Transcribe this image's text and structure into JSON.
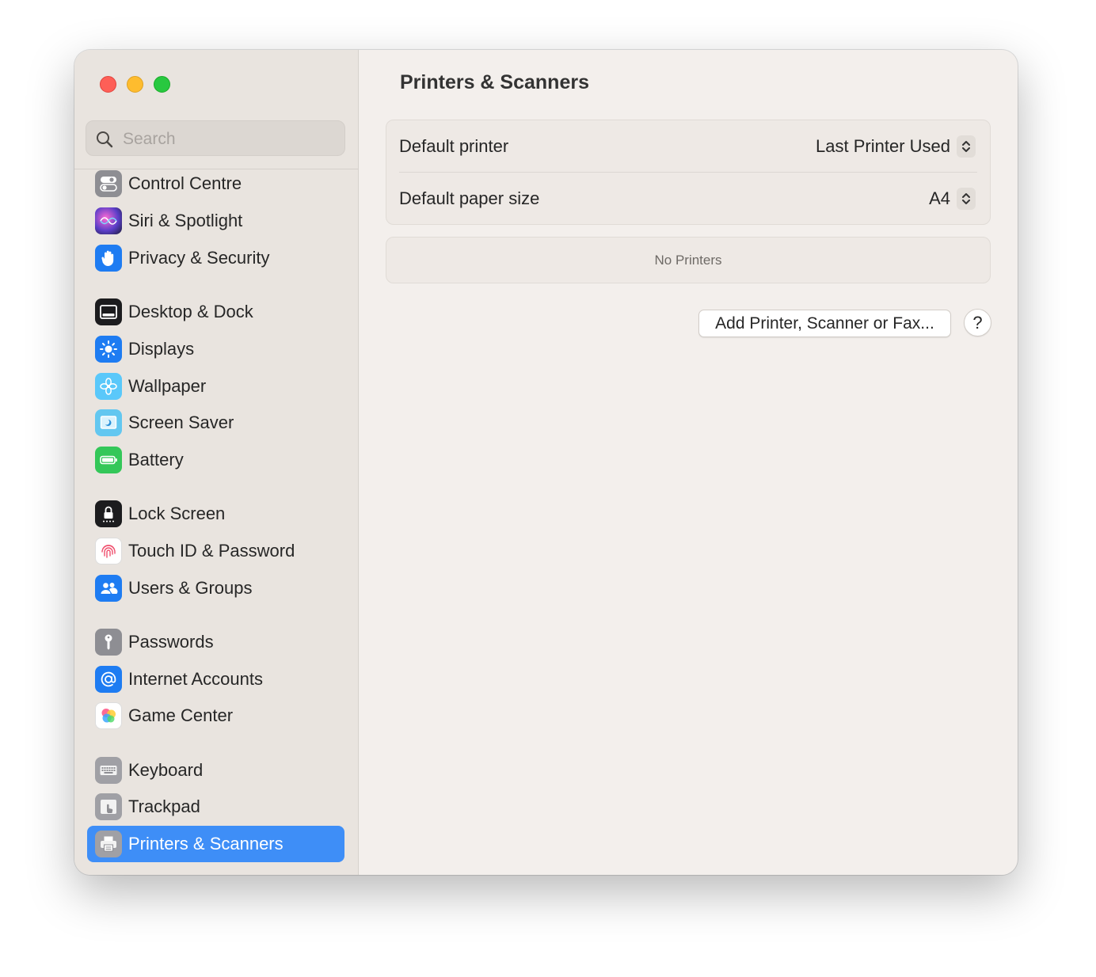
{
  "window": {
    "traffic_lights": {
      "close": "#fe5f57",
      "minimize": "#febc2e",
      "zoom": "#28c840"
    }
  },
  "sidebar": {
    "search_placeholder": "Search",
    "items": [
      {
        "label": "Control Centre",
        "icon": "control-centre-icon",
        "color": "#8e8e93"
      },
      {
        "label": "Siri & Spotlight",
        "icon": "siri-icon",
        "color": "#5b3ec8"
      },
      {
        "label": "Privacy & Security",
        "icon": "hand-icon",
        "color": "#1e7cf2"
      },
      {
        "label": "Desktop & Dock",
        "icon": "dock-icon",
        "color": "#1c1c1e"
      },
      {
        "label": "Displays",
        "icon": "sun-icon",
        "color": "#1e7cf2"
      },
      {
        "label": "Wallpaper",
        "icon": "flower-icon",
        "color": "#5ac8fa"
      },
      {
        "label": "Screen Saver",
        "icon": "screen-saver-icon",
        "color": "#63c7f0"
      },
      {
        "label": "Battery",
        "icon": "battery-icon",
        "color": "#34c759"
      },
      {
        "label": "Lock Screen",
        "icon": "lock-icon",
        "color": "#1c1c1e"
      },
      {
        "label": "Touch ID & Password",
        "icon": "fingerprint-icon",
        "color": "#ffffff"
      },
      {
        "label": "Users & Groups",
        "icon": "users-icon",
        "color": "#1e7cf2"
      },
      {
        "label": "Passwords",
        "icon": "key-icon",
        "color": "#8e8e93"
      },
      {
        "label": "Internet Accounts",
        "icon": "at-icon",
        "color": "#1e7cf2"
      },
      {
        "label": "Game Center",
        "icon": "game-center-icon",
        "color": "#ffffff"
      },
      {
        "label": "Keyboard",
        "icon": "keyboard-icon",
        "color": "#a0a0a5"
      },
      {
        "label": "Trackpad",
        "icon": "trackpad-icon",
        "color": "#a0a0a5"
      },
      {
        "label": "Printers & Scanners",
        "icon": "printer-icon",
        "color": "#a0a0a5",
        "selected": true
      }
    ]
  },
  "main": {
    "title": "Printers & Scanners",
    "settings": [
      {
        "label": "Default printer",
        "value": "Last Printer Used"
      },
      {
        "label": "Default paper size",
        "value": "A4"
      }
    ],
    "printers_empty": "No Printers",
    "add_button": "Add Printer, Scanner or Fax...",
    "help_button": "?"
  },
  "colors": {
    "accent": "#3e8ef7",
    "sidebar_bg": "#e9e4df",
    "content_bg": "#f3efec"
  }
}
